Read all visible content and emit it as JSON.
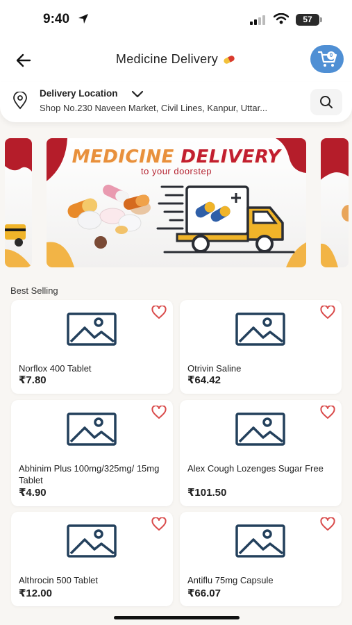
{
  "status_bar": {
    "time": "9:40",
    "battery": "57"
  },
  "header": {
    "title": "Medicine Delivery",
    "cart_count": "0"
  },
  "location": {
    "label": "Delivery Location",
    "address": "Shop No.230 Naveen Market, Civil Lines, Kanpur, Uttar..."
  },
  "banner": {
    "title_part1": "MEDICINE",
    "title_part2": "DELIVERY",
    "subtitle": "to your doorstep"
  },
  "section": {
    "title": "Best Selling"
  },
  "products": [
    {
      "name": "Norflox 400 Tablet",
      "price": "₹7.80"
    },
    {
      "name": "Otrivin Saline",
      "price": "₹64.42"
    },
    {
      "name": "Abhinim Plus 100mg/325mg/ 15mg Tablet",
      "price": "₹4.90"
    },
    {
      "name": "Alex Cough Lozenges Sugar Free",
      "price": "₹101.50"
    },
    {
      "name": "Althrocin 500 Tablet",
      "price": "₹12.00"
    },
    {
      "name": "Antiflu 75mg Capsule",
      "price": "₹66.07"
    }
  ],
  "icons": {
    "back": "arrow-left-icon",
    "cart": "cart-icon",
    "pin": "location-pin-icon",
    "chevron": "chevron-down-icon",
    "search": "search-icon",
    "heart": "heart-outline-icon",
    "image_placeholder": "image-placeholder-icon"
  },
  "colors": {
    "accent": "#4f8fd4",
    "heart": "#d94a4a",
    "placeholder": "#23405c",
    "banner_red": "#c21f2f",
    "banner_orange": "#e8903c"
  }
}
